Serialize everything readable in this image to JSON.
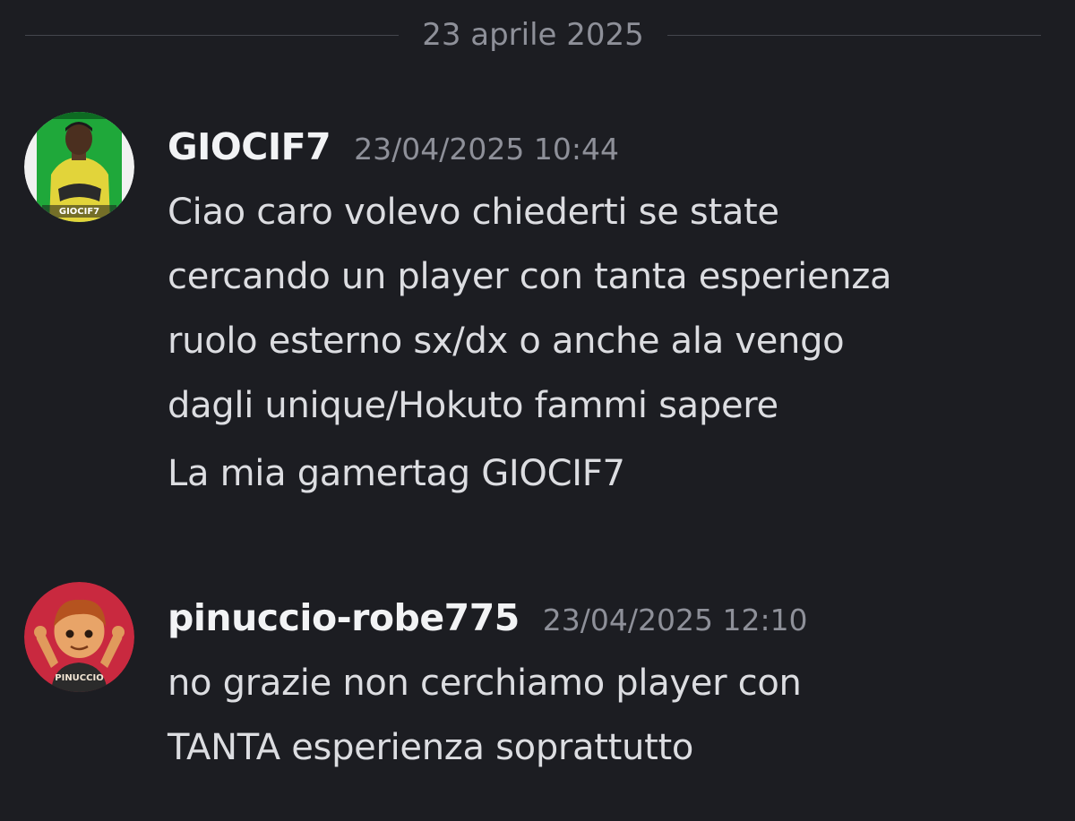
{
  "divider": {
    "date": "23 aprile 2025"
  },
  "messages": [
    {
      "username": "GIOCIF7",
      "timestamp": "23/04/2025 10:44",
      "avatar": {
        "label": "GIOCIF7",
        "icon": "player-photo-avatar",
        "bg": "#1fa83a",
        "accent": "#e7d633"
      },
      "paragraphs": [
        [
          "Ciao caro volevo chiederti se state",
          "cercando un player con tanta esperienza",
          "ruolo esterno sx/dx o anche ala vengo",
          "dagli unique/Hokuto fammi sapere"
        ],
        [
          "La mia gamertag GIOCIF7"
        ]
      ]
    },
    {
      "username": "pinuccio-robe775",
      "timestamp": "23/04/2025 12:10",
      "avatar": {
        "label": "PINUCCIO",
        "icon": "cartoon-boy-avatar",
        "bg": "#c9293f",
        "accent": "#d98a4a"
      },
      "paragraphs": [
        [
          "no grazie non cerchiamo player con",
          "TANTA esperienza soprattutto"
        ]
      ]
    }
  ]
}
